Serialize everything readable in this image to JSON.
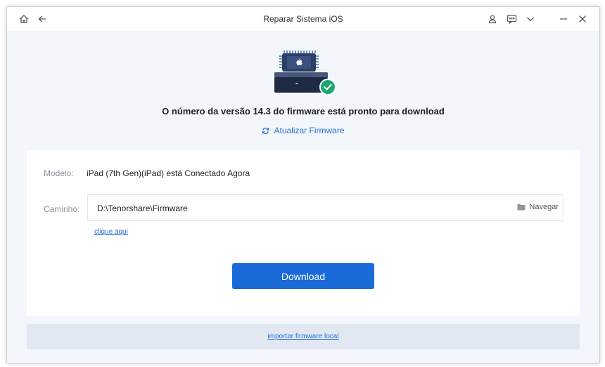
{
  "window": {
    "title": "Reparar Sistema iOS"
  },
  "titlebar_icons": [
    "home-icon",
    "back-arrow-icon",
    "user-icon",
    "feedback-icon",
    "chevron-down-icon",
    "minimize-icon",
    "close-icon"
  ],
  "hero": {
    "headline": "O número da versão 14.3 do firmware está pronto para download",
    "update_link": "Atualizar Firmware"
  },
  "details": {
    "model_label": "Modelo:",
    "model_value": "iPad (7th Gen)(iPad) está Conectado Agora",
    "path_label": "Caminho:",
    "path_value": "D:\\Tenorshare\\Firmware",
    "browse_label": "Navegar",
    "click_here": "clique aqui"
  },
  "actions": {
    "download_label": "Download",
    "import_label": "importar firmware local"
  },
  "colors": {
    "accent": "#1a6bd8",
    "link": "#2a6fd6",
    "success": "#1ea672",
    "background": "#f3f7fb"
  }
}
